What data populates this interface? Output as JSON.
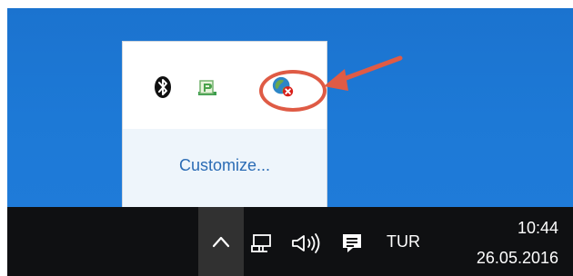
{
  "tray_flyout": {
    "customize_label": "Customize..."
  },
  "taskbar": {
    "language": "TUR",
    "time": "10:44",
    "date": "26.05.2016"
  },
  "icons": {
    "bluetooth": "bluetooth-icon",
    "pcbox": "pc-icon",
    "network_error": "network-error-icon",
    "overflow": "chevron-up-icon",
    "network_monitor": "network-monitor-icon",
    "volume": "volume-icon",
    "action_center": "action-center-icon"
  },
  "colors": {
    "desktop_blue": "#1d79d6",
    "link_blue": "#2b6cb5",
    "annotation_red": "#df5b45",
    "taskbar_black": "#0f1012"
  }
}
